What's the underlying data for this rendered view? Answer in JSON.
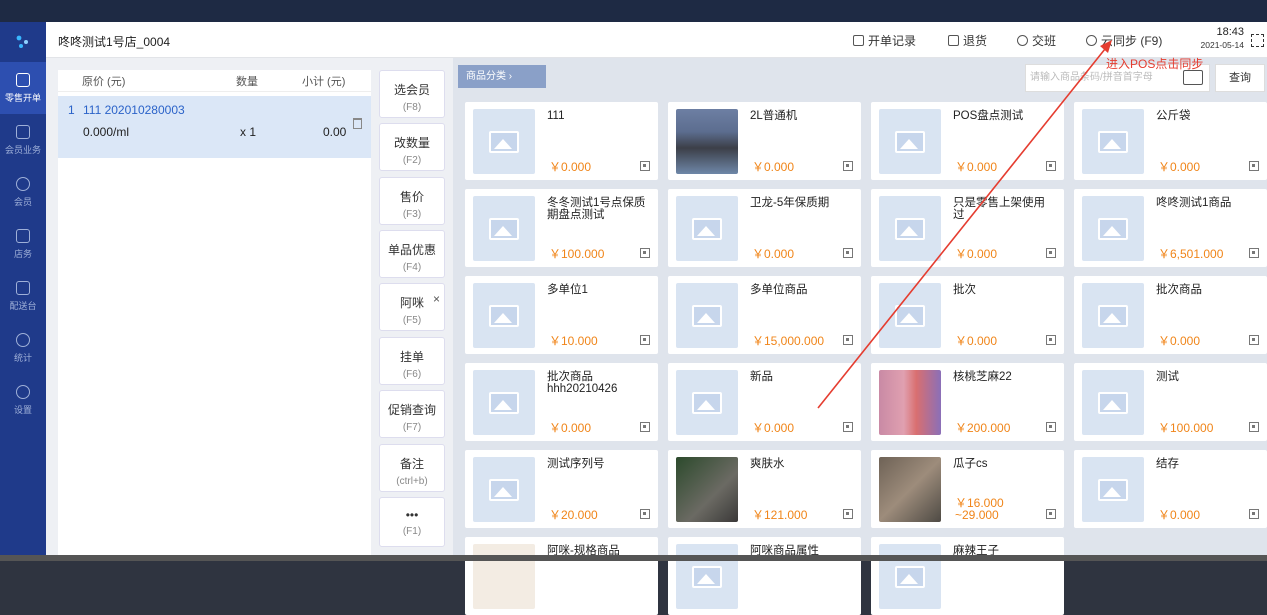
{
  "header": {
    "store": "咚咚测试1号店_0004",
    "actions": [
      "开单记录",
      "退货",
      "交班",
      "云同步 (F9)"
    ],
    "time": "18:43",
    "date": "2021-05-14"
  },
  "annotation": "进入POS点击同步",
  "sidebar": [
    {
      "label": "零售开单",
      "icon": "receipt-icon"
    },
    {
      "label": "会员业务",
      "icon": "grid-icon"
    },
    {
      "label": "会员",
      "icon": "diamond-icon"
    },
    {
      "label": "店务",
      "icon": "store-icon"
    },
    {
      "label": "配送台",
      "icon": "delivery-icon"
    },
    {
      "label": "统计",
      "icon": "chart-icon"
    },
    {
      "label": "设置",
      "icon": "settings-icon"
    }
  ],
  "cart": {
    "columns": [
      "原价 (元)",
      "数量",
      "小计 (元)"
    ],
    "items": [
      {
        "index": "1",
        "name": "111 202010280003",
        "unit_price": "0.000/ml",
        "qty": "x 1",
        "subtotal": "0.00"
      }
    ]
  },
  "functions": [
    {
      "label": "选会员",
      "key": "(F8)"
    },
    {
      "label": "改数量",
      "key": "(F2)"
    },
    {
      "label": "售价",
      "key": "(F3)"
    },
    {
      "label": "单品优惠",
      "key": "(F4)"
    },
    {
      "label": "阿咪",
      "key": "(F5)"
    },
    {
      "label": "挂单",
      "key": "(F6)"
    },
    {
      "label": "促销查询",
      "key": "(F7)"
    },
    {
      "label": "备注",
      "key": "(ctrl+b)"
    },
    {
      "label": "•••",
      "key": "(F1)"
    }
  ],
  "catalog": {
    "category_tab": "商品分类  ›",
    "search_placeholder": "请输入商品条码/拼音首字母",
    "search_button": "查询",
    "products": [
      {
        "name": "111",
        "price": "￥0.000",
        "thumb": "placeholder"
      },
      {
        "name": "2L普通机",
        "price": "￥0.000",
        "thumb": "photo"
      },
      {
        "name": "POS盘点测试",
        "price": "￥0.000",
        "thumb": "placeholder"
      },
      {
        "name": "公斤袋",
        "price": "￥0.000",
        "thumb": "placeholder"
      },
      {
        "name": "冬冬测试1号点保质期盘点测试",
        "price": "￥100.000",
        "thumb": "placeholder"
      },
      {
        "name": "卫龙-5年保质期",
        "price": "￥0.000",
        "thumb": "placeholder"
      },
      {
        "name": "只是零售上架使用过",
        "price": "￥0.000",
        "thumb": "placeholder"
      },
      {
        "name": "咚咚测试1商品",
        "price": "￥6,501.000",
        "thumb": "placeholder"
      },
      {
        "name": "多单位1",
        "price": "￥10.000",
        "thumb": "placeholder"
      },
      {
        "name": "多单位商品",
        "price": "￥15,000.000",
        "thumb": "placeholder"
      },
      {
        "name": "批次",
        "price": "￥0.000",
        "thumb": "placeholder"
      },
      {
        "name": "批次商品",
        "price": "￥0.000",
        "thumb": "placeholder"
      },
      {
        "name": "批次商品hhh20210426",
        "price": "￥0.000",
        "thumb": "placeholder"
      },
      {
        "name": "新品",
        "price": "￥0.000",
        "thumb": "placeholder"
      },
      {
        "name": "核桃芝麻22",
        "price": "￥200.000",
        "thumb": "mosaic"
      },
      {
        "name": "测试",
        "price": "￥100.000",
        "thumb": "placeholder"
      },
      {
        "name": "测试序列号",
        "price": "￥20.000",
        "thumb": "placeholder"
      },
      {
        "name": "爽肤水",
        "price": "￥121.000",
        "thumb": "dark"
      },
      {
        "name": "瓜子cs",
        "price": "￥16.000\n~29.000",
        "thumb": "nuts"
      },
      {
        "name": "结存",
        "price": "￥0.000",
        "thumb": "placeholder"
      },
      {
        "name": "阿咪-规格商品",
        "price": "",
        "thumb": "light"
      },
      {
        "name": "阿咪商品属性",
        "price": "",
        "thumb": "placeholder"
      },
      {
        "name": "麻辣王子",
        "price": "",
        "thumb": "placeholder"
      }
    ]
  }
}
